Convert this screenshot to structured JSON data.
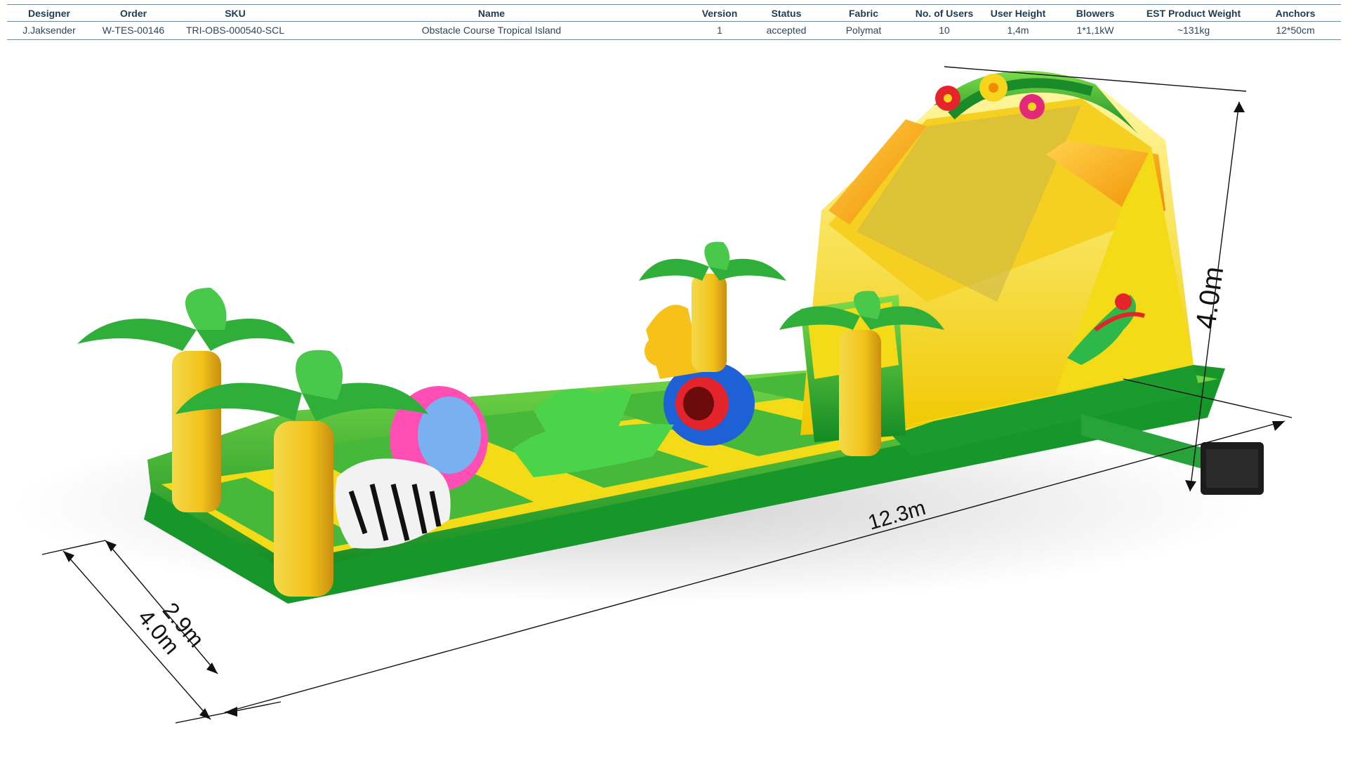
{
  "spec_table": {
    "headers": [
      "Designer",
      "Order",
      "SKU",
      "Name",
      "Version",
      "Status",
      "Fabric",
      "No. of Users",
      "User  Height",
      "Blowers",
      "EST Product Weight",
      "Anchors"
    ],
    "row": [
      "J.Jaksender",
      "W-TES-00146",
      "TRI-OBS-000540-SCL",
      "Obstacle Course Tropical Island",
      "1",
      "accepted",
      "Polymat",
      "10",
      "1,4m",
      "1*1,1kW",
      "~131kg",
      "12*50cm"
    ]
  },
  "dimensions": {
    "length": "12.3m",
    "height": "4.0m",
    "width_inner": "2.9m",
    "width_outer": "4.0m"
  },
  "colors": {
    "table_text": "#1f3b57",
    "green": "#1fa32e",
    "yellow": "#f3dc17",
    "orange": "#f39c12"
  }
}
